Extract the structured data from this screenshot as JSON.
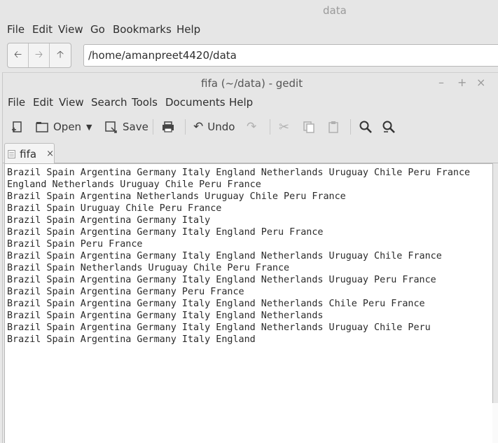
{
  "file_manager": {
    "title": "data",
    "menu": [
      "File",
      "Edit",
      "View",
      "Go",
      "Bookmarks",
      "Help"
    ],
    "path": "/home/amanpreet4420/data"
  },
  "gedit": {
    "title": "fifa (~/data) - gedit",
    "window_controls": [
      "–",
      "+",
      "×"
    ],
    "menu": [
      "File",
      "Edit",
      "View",
      "Search",
      "Tools",
      "Documents",
      "Help"
    ],
    "toolbar": {
      "open_label": "Open",
      "save_label": "Save",
      "undo_label": "Undo"
    },
    "tab": {
      "label": "fifa",
      "close": "×"
    },
    "lines": [
      "Brazil Spain Argentina Germany Italy England Netherlands Uruguay Chile Peru France",
      "England Netherlands Uruguay Chile Peru France",
      "Brazil Spain Argentina Netherlands Uruguay Chile Peru France",
      "Brazil Spain Uruguay Chile Peru France",
      "Brazil Spain Argentina Germany Italy",
      "Brazil Spain Argentina Germany Italy England Peru France",
      "Brazil Spain Peru France",
      "Brazil Spain Argentina Germany Italy England Netherlands Uruguay Chile France",
      "Brazil Spain Netherlands Uruguay Chile Peru France",
      "Brazil Spain Argentina Germany Italy England Netherlands Uruguay Peru France",
      "Brazil Spain Argentina Germany Peru France",
      "Brazil Spain Argentina Germany Italy England Netherlands Chile Peru France",
      "Brazil Spain Argentina Germany Italy England Netherlands",
      "Brazil Spain Argentina Germany Italy England Netherlands Uruguay Chile Peru",
      "Brazil Spain Argentina Germany Italy England"
    ]
  }
}
